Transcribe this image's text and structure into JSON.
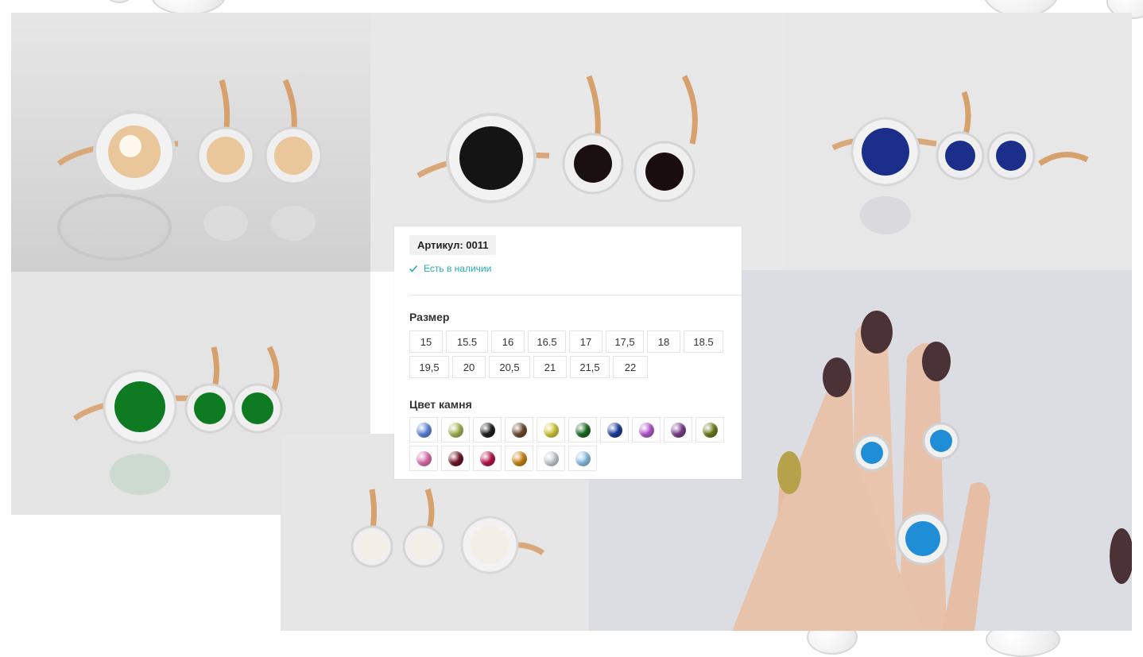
{
  "product": {
    "sku_label": "Артикул: 0011",
    "stock_status": "Есть в наличии",
    "size_title": "Размер",
    "sizes": [
      "15",
      "15.5",
      "16",
      "16.5",
      "17",
      "17,5",
      "18",
      "18.5",
      "19,5",
      "20",
      "20,5",
      "21",
      "21,5",
      "22"
    ],
    "color_title": "Цвет камня",
    "stone_colors": [
      {
        "name": "light-blue",
        "hex": "#5f86dc"
      },
      {
        "name": "olive-light",
        "hex": "#a6b556"
      },
      {
        "name": "black",
        "hex": "#1e1e1e"
      },
      {
        "name": "brown",
        "hex": "#6b4a2e"
      },
      {
        "name": "yellow",
        "hex": "#d2c93a"
      },
      {
        "name": "emerald",
        "hex": "#1a6b22"
      },
      {
        "name": "sapphire",
        "hex": "#1c3b9c"
      },
      {
        "name": "violet-light",
        "hex": "#b35ad0"
      },
      {
        "name": "purple",
        "hex": "#7b3f8e"
      },
      {
        "name": "olive",
        "hex": "#6e7d1c"
      },
      {
        "name": "pink",
        "hex": "#dd6fae"
      },
      {
        "name": "garnet",
        "hex": "#6d1424"
      },
      {
        "name": "ruby",
        "hex": "#b8154a"
      },
      {
        "name": "amber",
        "hex": "#c98416"
      },
      {
        "name": "clear",
        "hex": "#c9d0d6"
      },
      {
        "name": "aquamarine",
        "hex": "#8fc1e4"
      }
    ]
  },
  "photos": [
    {
      "name": "photo-champagne-set",
      "stone": "#e9c79a"
    },
    {
      "name": "photo-black-set",
      "stone": "#141414"
    },
    {
      "name": "photo-sapphire-set",
      "stone": "#1b2f8a"
    },
    {
      "name": "photo-emerald-set",
      "stone": "#0e7a22"
    },
    {
      "name": "photo-clear-set",
      "stone": "#f3efe6"
    },
    {
      "name": "photo-topaz-hand",
      "stone": "#1f8ed6"
    }
  ],
  "colors": {
    "accent": "#28a9b3",
    "border": "#e4e4e4",
    "sku_bg": "#f1f1f1"
  }
}
